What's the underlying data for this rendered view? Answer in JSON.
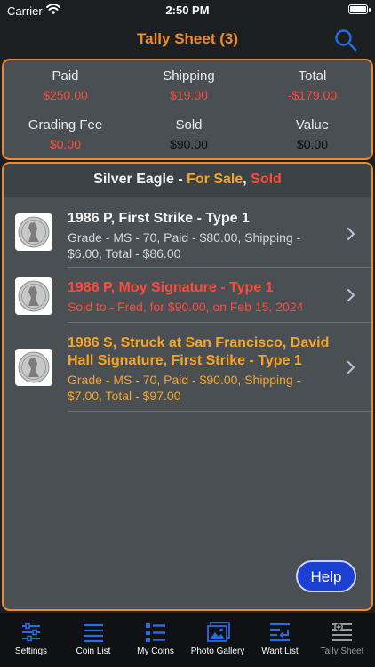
{
  "status_bar": {
    "carrier": "Carrier",
    "time": "2:50 PM"
  },
  "nav": {
    "title": "Tally Sheet (3)",
    "search_icon": "search-icon"
  },
  "summary": {
    "paid": {
      "label": "Paid",
      "value": "$250.00"
    },
    "shipping": {
      "label": "Shipping",
      "value": "$19.00"
    },
    "total": {
      "label": "Total",
      "value": "-$179.00"
    },
    "grading_fee": {
      "label": "Grading Fee",
      "value": "$0.00"
    },
    "sold": {
      "label": "Sold",
      "value": "$90.00"
    },
    "value": {
      "label": "Value",
      "value": "$0.00"
    }
  },
  "section": {
    "name": "Silver Eagle",
    "sep1": " - ",
    "for_sale": "For Sale",
    "sep2": ", ",
    "sold": "Sold"
  },
  "items": [
    {
      "title": "1986 P, First Strike - Type 1",
      "detail": "Grade - MS - 70, Paid - $80.00, Shipping - $6.00, Total - $86.00",
      "status": "normal"
    },
    {
      "title": "1986 P, Moy Signature - Type 1",
      "detail": "Sold to - Fred, for $90.00, on Feb 15, 2024",
      "status": "sold"
    },
    {
      "title": "1986 S, Struck at San Francisco, David Hall Signature, First Strike - Type 1",
      "detail": "Grade - MS - 70, Paid - $90.00, Shipping - $7.00, Total - $97.00",
      "status": "for-sale"
    }
  ],
  "help": {
    "label": "Help"
  },
  "tabs": [
    {
      "label": "Settings",
      "icon": "sliders-icon"
    },
    {
      "label": "Coin List",
      "icon": "list-icon"
    },
    {
      "label": "My Coins",
      "icon": "grid-list-icon"
    },
    {
      "label": "Photo Gallery",
      "icon": "photo-icon"
    },
    {
      "label": "Want List",
      "icon": "want-list-icon"
    },
    {
      "label": "Tally Sheet",
      "icon": "tally-icon",
      "active": true
    }
  ],
  "colors": {
    "accent": "#f08a28",
    "sold_red": "#ff4a3a",
    "for_sale_orange": "#f5a524",
    "help_blue": "#1a3fd1",
    "tab_blue": "#2a6be0"
  }
}
